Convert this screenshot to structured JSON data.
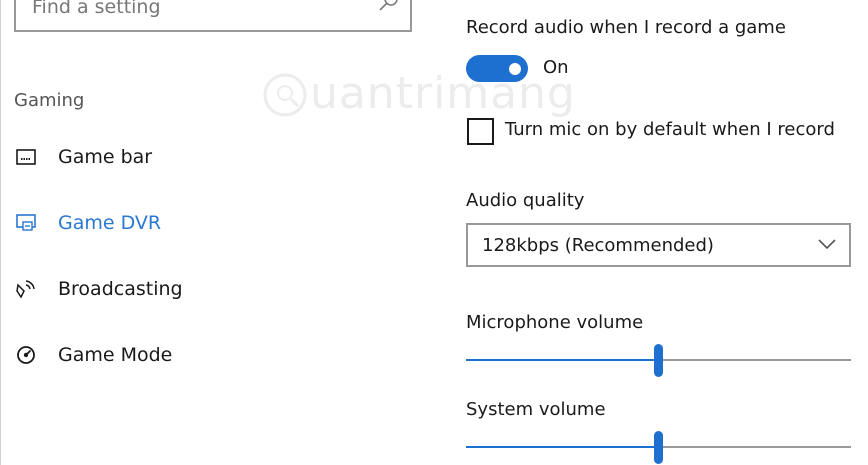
{
  "search": {
    "placeholder": "Find a setting"
  },
  "sidebar": {
    "section_label": "Gaming",
    "items": [
      {
        "label": "Game bar",
        "icon": "game-bar-icon",
        "active": false
      },
      {
        "label": "Game DVR",
        "icon": "game-dvr-icon",
        "active": true
      },
      {
        "label": "Broadcasting",
        "icon": "broadcasting-icon",
        "active": false
      },
      {
        "label": "Game Mode",
        "icon": "game-mode-icon",
        "active": false
      }
    ]
  },
  "main": {
    "record_audio": {
      "title": "Record audio when I record a game",
      "state_label": "On",
      "on": true
    },
    "mic_checkbox": {
      "label": "Turn mic on by default when I record",
      "checked": false
    },
    "audio_quality": {
      "title": "Audio quality",
      "selected": "128kbps (Recommended)"
    },
    "microphone_volume": {
      "title": "Microphone volume",
      "value_fraction": 0.5
    },
    "system_volume": {
      "title": "System volume",
      "value_fraction": 0.5
    }
  },
  "watermark": {
    "text": "uantrimang"
  },
  "colors": {
    "accent": "#1d6fd0",
    "active_nav": "#2a78d2",
    "text": "#1a1a1a",
    "muted": "#555555"
  }
}
